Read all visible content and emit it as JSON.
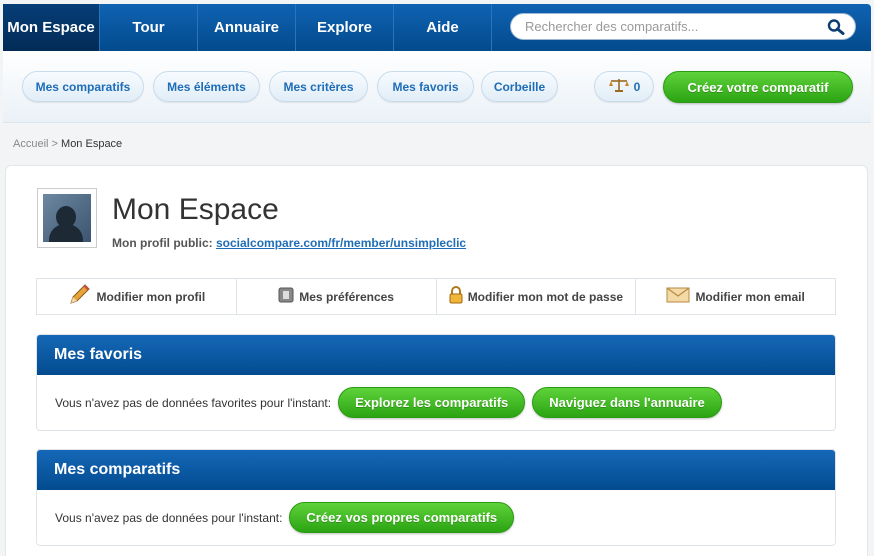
{
  "nav": {
    "items": [
      "Mon Espace",
      "Tour",
      "Annuaire",
      "Explore",
      "Aide"
    ],
    "search_placeholder": "Rechercher des comparatifs..."
  },
  "subnav": {
    "items": [
      "Mes comparatifs",
      "Mes éléments",
      "Mes critères",
      "Mes favoris",
      "Corbeille"
    ],
    "compare_count": "0",
    "create_button": "Créez votre comparatif"
  },
  "breadcrumb": {
    "home": "Accueil",
    "separator": ">",
    "current": "Mon Espace"
  },
  "profile": {
    "title": "Mon Espace",
    "public_label": "Mon profil public:",
    "public_url": "socialcompare.com/fr/member/unsimpleclic"
  },
  "actions": [
    {
      "label": "Modifier mon profil",
      "icon": "pencil-icon"
    },
    {
      "label": "Mes préférences",
      "icon": "preferences-icon"
    },
    {
      "label": "Modifier mon mot de passe",
      "icon": "lock-icon"
    },
    {
      "label": "Modifier mon email",
      "icon": "envelope-icon"
    }
  ],
  "favorites": {
    "title": "Mes favoris",
    "empty_text": "Vous n'avez pas de données favorites pour l'instant:",
    "button1": "Explorez les comparatifs",
    "button2": "Naviguez dans l'annuaire"
  },
  "comparisons": {
    "title": "Mes comparatifs",
    "empty_text": "Vous n'avez pas de données pour l'instant:",
    "button1": "Créez vos propres comparatifs"
  },
  "colors": {
    "nav_blue": "#0f63b3",
    "green": "#2ba413",
    "link": "#1f6db7"
  }
}
